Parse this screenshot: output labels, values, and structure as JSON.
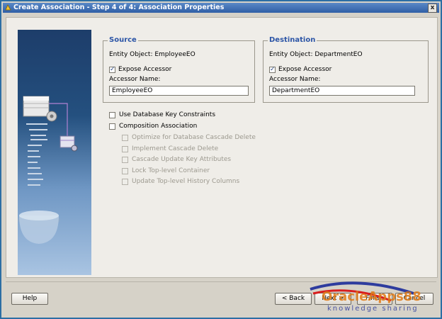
{
  "window": {
    "title": "Create Association - Step 4 of 4: Association Properties",
    "close": "x"
  },
  "source": {
    "legend": "Source",
    "entity_object": "Entity Object: EmployeeEO",
    "expose_accessor": {
      "label": "Expose Accessor",
      "checked": true
    },
    "accessor_name_label": "Accessor Name:",
    "accessor_name_value": "EmployeeEO"
  },
  "destination": {
    "legend": "Destination",
    "entity_object": "Entity Object: DepartmentEO",
    "expose_accessor": {
      "label": "Expose Accessor",
      "checked": true
    },
    "accessor_name_label": "Accessor Name:",
    "accessor_name_value": "DepartmentEO"
  },
  "options": {
    "use_db_key_constraints": {
      "label": "Use Database Key Constraints",
      "checked": false
    },
    "composition_association": {
      "label": "Composition Association",
      "checked": false
    },
    "sub_options": [
      {
        "label": "Optimize for Database Cascade Delete",
        "checked": false
      },
      {
        "label": "Implement Cascade Delete",
        "checked": false
      },
      {
        "label": "Cascade Update Key Attributes",
        "checked": false
      },
      {
        "label": "Lock Top-level Container",
        "checked": false
      },
      {
        "label": "Update Top-level History Columns",
        "checked": false
      }
    ]
  },
  "buttons": {
    "help": "Help",
    "back": "< Back",
    "next": "Next >",
    "finish": "Finish",
    "cancel": "Cancel"
  },
  "watermark": {
    "line1": "OracleApps88",
    "line2": "knowledge sharing"
  },
  "colors": {
    "title_bar": "#2f5fa6",
    "group_legend": "#2c55a6",
    "sidebar_top": "#1d3d6a",
    "sidebar_bottom": "#a9c4e2"
  }
}
